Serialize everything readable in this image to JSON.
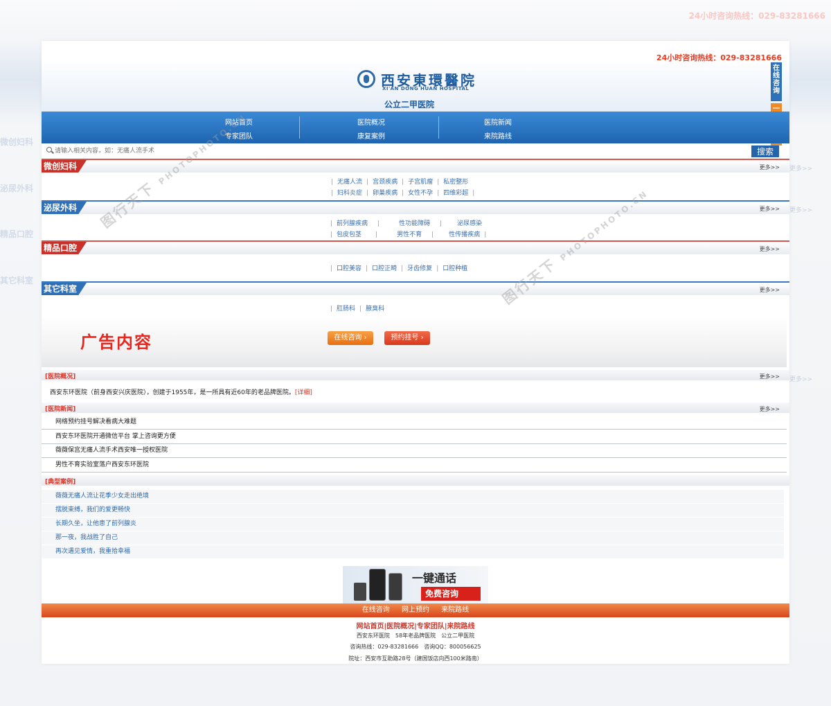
{
  "hotline": "24小时咨询热线：029-83281666",
  "header": {
    "logo_cn": "西安東環醫院",
    "logo_en": "XI'AN DONG HUAN HOSPITAL",
    "subtitle": "公立二甲医院"
  },
  "float": {
    "online": "在线咨询",
    "call": "一键通话"
  },
  "nav": [
    {
      "top": "网站首页",
      "bottom": "专家团队"
    },
    {
      "top": "医院概况",
      "bottom": "康复案例"
    },
    {
      "top": "医院新闻",
      "bottom": "来院路线"
    }
  ],
  "search": {
    "placeholder": "请输入相关内容，如：无痛人流手术",
    "button": "搜索"
  },
  "more": "更多>>",
  "sections": {
    "s1": {
      "title": "微创妇科",
      "row1": [
        "无痛人流",
        "宫颈疾病",
        "子宫肌瘤",
        "私密整形"
      ],
      "row2": [
        "妇科炎症",
        "卵巢疾病",
        "女性不孕",
        "四维彩超"
      ]
    },
    "s2": {
      "title": "泌尿外科",
      "row1": [
        "前列腺疾病",
        "性功能障碍",
        "泌尿感染"
      ],
      "row2": [
        "包皮包茎",
        "男性不育",
        "性传播疾病"
      ]
    },
    "s3": {
      "title": "精品口腔",
      "row1": [
        "口腔美容",
        "口腔正畸",
        "牙齿修复",
        "口腔种植"
      ]
    },
    "s4": {
      "title": "其它科室",
      "row1": [
        "肛肠科",
        "腋臭科"
      ]
    }
  },
  "ad": {
    "text": "广告内容",
    "btn_online": "在线咨询 ›",
    "btn_book": "预约挂号 ›"
  },
  "overview": {
    "title": "[医院概况]",
    "text": "西安东环医院（前身西安兴庆医院），创建于1955年，是一所具有近60年的老品牌医院。",
    "detail": "[详细]"
  },
  "news": {
    "title": "[医院新闻]",
    "items": [
      "网络预约挂号解决看病大难题",
      "西安东环医院开通微信平台 掌上咨询更方便",
      "薇薇保宫无痛人流手术西安唯一授权医院",
      "男性不育实验室落户西安东环医院"
    ]
  },
  "cases": {
    "title": "[典型案例]",
    "items": [
      "薇薇无痛人流让花季少女走出绝境",
      "摆脱束缚，我们的爱更畅快",
      "长期久坐，让他患了前列腺炎",
      "那一夜，我战胜了自己",
      "再次遇见爱情，我重拾幸福"
    ]
  },
  "banner": {
    "title": "一键通话",
    "cta": "免费咨询"
  },
  "footer": {
    "bar": [
      "在线咨询",
      "网上预约",
      "来院路线"
    ],
    "links": "网站首页|医院概况|专家团队|来院路线",
    "line1": "西安东环医院　58年老品牌医院　公立二甲医院",
    "line2": "咨询热线：029-83281666　咨询QQ：800056625",
    "line3": "院址：西安市互助路28号（建国饭店向西100米路南）"
  },
  "watermark": {
    "cn": "图行天下",
    "en": "PHOTOPHOTO.CN"
  },
  "colors": {
    "nav_blue": "#1e64b0",
    "accent_red": "#c8322b",
    "orange": "#e76f10"
  }
}
